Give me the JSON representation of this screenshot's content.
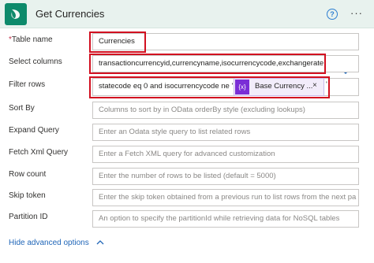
{
  "header": {
    "title": "Get Currencies",
    "help_label": "?",
    "more_label": "···"
  },
  "fields": {
    "table_name": {
      "label": "Table name",
      "required_mark": "*",
      "value": "Currencies"
    },
    "select_columns": {
      "label": "Select columns",
      "value": "transactioncurrencyid,currencyname,isocurrencycode,exchangerate"
    },
    "filter_rows": {
      "label": "Filter rows",
      "value": "statecode eq 0 and isocurrencycode ne '",
      "token_icon": "{x}",
      "token_label": "Base Currency ...",
      "token_close": "×",
      "trailing": "'"
    },
    "sort_by": {
      "label": "Sort By",
      "placeholder": "Columns to sort by in OData orderBy style (excluding lookups)"
    },
    "expand_query": {
      "label": "Expand Query",
      "placeholder": "Enter an Odata style query to list related rows"
    },
    "fetch_xml_query": {
      "label": "Fetch Xml Query",
      "placeholder": "Enter a Fetch XML query for advanced customization"
    },
    "row_count": {
      "label": "Row count",
      "placeholder": "Enter the number of rows to be listed (default = 5000)"
    },
    "skip_token": {
      "label": "Skip token",
      "placeholder": "Enter the skip token obtained from a previous run to list rows from the next pa"
    },
    "partition_id": {
      "label": "Partition ID",
      "placeholder": "An option to specify the partitionId while retrieving data for NoSQL tables"
    }
  },
  "footer": {
    "toggle_label": "Hide advanced options"
  },
  "colors": {
    "accent": "#0d8a6b",
    "highlight": "#d21020",
    "token": "#7a2ed6",
    "link": "#2066b8"
  }
}
